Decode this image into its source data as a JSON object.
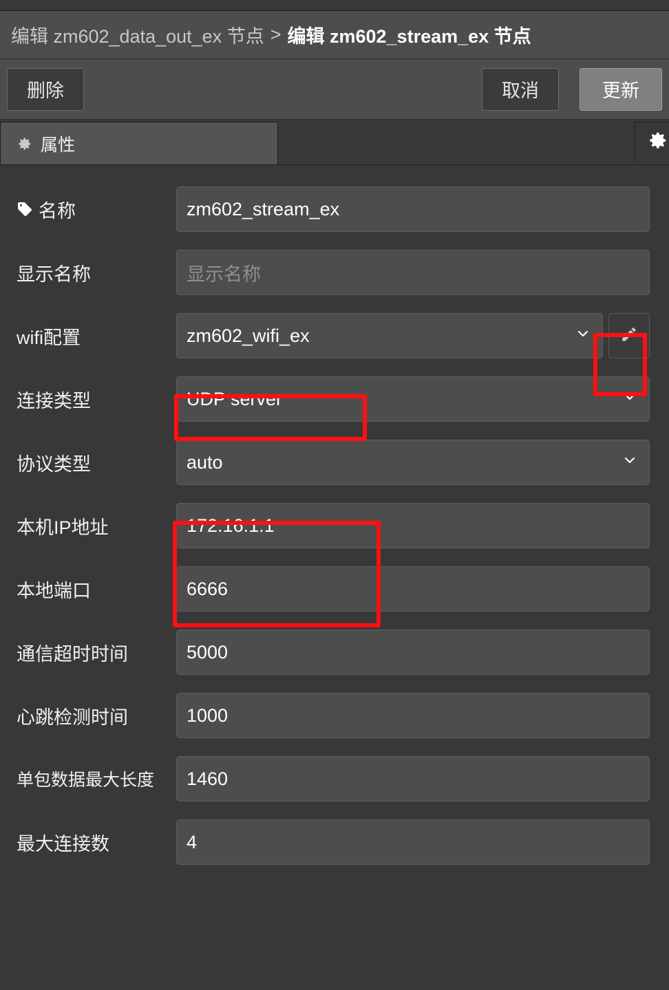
{
  "breadcrumb": {
    "previous": "编辑 zm602_data_out_ex 节点",
    "separator": ">",
    "current": "编辑 zm602_stream_ex 节点"
  },
  "actions": {
    "delete_label": "删除",
    "cancel_label": "取消",
    "update_label": "更新"
  },
  "tabs": {
    "properties": {
      "label": "属性",
      "icon": "gear-icon"
    },
    "right_gear_icon": "gear-icon"
  },
  "form": {
    "rows": [
      {
        "label": "名称",
        "icon": "tag-icon",
        "type": "text",
        "value": "zm602_stream_ex",
        "placeholder": ""
      },
      {
        "label": "显示名称",
        "type": "text",
        "value": "",
        "placeholder": "显示名称"
      },
      {
        "label": "wifi配置",
        "type": "select",
        "value": "zm602_wifi_ex",
        "has_edit_button": true,
        "edit_icon": "pencil-icon"
      },
      {
        "label": "连接类型",
        "type": "select",
        "value": "UDP server"
      },
      {
        "label": "协议类型",
        "type": "select",
        "value": "auto"
      },
      {
        "label": "本机IP地址",
        "type": "text",
        "value": "172.16.1.1",
        "placeholder": ""
      },
      {
        "label": "本地端口",
        "type": "text",
        "value": "6666",
        "placeholder": ""
      },
      {
        "label": "通信超时时间",
        "type": "text",
        "value": "5000",
        "placeholder": ""
      },
      {
        "label": "心跳检测时间",
        "type": "text",
        "value": "1000",
        "placeholder": ""
      },
      {
        "label": "单包数据最大长度",
        "type": "text",
        "value": "1460",
        "placeholder": ""
      },
      {
        "label": "最大连接数",
        "type": "text",
        "value": "4",
        "placeholder": ""
      }
    ]
  },
  "annotations": {
    "highlight_color": "#ff1010",
    "boxes": [
      {
        "target": "wifi-edit-button"
      },
      {
        "target": "connection-type-value"
      },
      {
        "target": "local-ip-and-port-fields"
      }
    ]
  },
  "colors": {
    "background": "#383838",
    "header": "#4d4d4d",
    "field": "#4d4d4d",
    "tab_active": "#545454",
    "button_primary": "#808080",
    "text": "#ffffff",
    "placeholder": "#8e8e8e"
  }
}
